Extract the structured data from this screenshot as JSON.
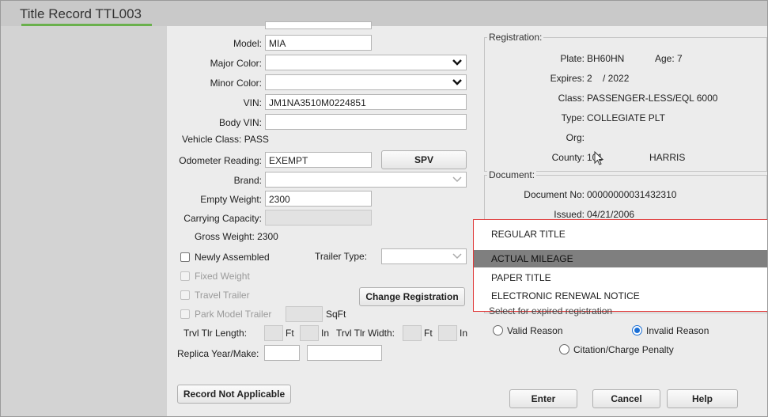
{
  "window": {
    "title": "Title Record TTL003"
  },
  "vehicle": {
    "model_label": "Model:",
    "model_value": "MIA",
    "major_color_label": "Major Color:",
    "major_color_value": "",
    "minor_color_label": "Minor Color:",
    "minor_color_value": "",
    "vin_label": "VIN:",
    "vin_value": "JM1NA3510M0224851",
    "body_vin_label": "Body VIN:",
    "body_vin_value": "",
    "vehicle_class_label": "Vehicle Class:",
    "vehicle_class_value": "PASS",
    "odometer_label": "Odometer Reading:",
    "odometer_value": "EXEMPT",
    "spv_label": "SPV",
    "brand_label": "Brand:",
    "brand_value": "",
    "empty_weight_label": "Empty Weight:",
    "empty_weight_value": "2300",
    "carrying_capacity_label": "Carrying Capacity:",
    "carrying_capacity_value": "",
    "gross_weight_label": "Gross Weight:",
    "gross_weight_value": "2300",
    "newly_assembled_label": "Newly Assembled",
    "trailer_type_label": "Trailer Type:",
    "trailer_type_value": "",
    "fixed_weight_label": "Fixed Weight",
    "travel_trailer_label": "Travel Trailer",
    "change_registration_label": "Change Registration",
    "park_model_trailer_label": "Park Model Trailer",
    "sqft_label": "SqFt",
    "trvl_tlr_length_label": "Trvl Tlr Length:",
    "ft_label": "Ft",
    "in_label": "In",
    "trvl_tlr_width_label": "Trvl Tlr Width:",
    "replica_label": "Replica Year/Make:",
    "record_not_applicable_label": "Record Not Applicable"
  },
  "registration": {
    "legend": "Registration:",
    "plate_label": "Plate:",
    "plate_value": "BH60HN",
    "age_label": "Age:",
    "age_value": "7",
    "expires_label": "Expires:",
    "expires_value": "2    / 2022",
    "class_label": "Class:",
    "class_value": "PASSENGER-LESS/EQL 6000",
    "type_label": "Type:",
    "type_value": "COLLEGIATE PLT",
    "org_label": "Org:",
    "org_value": "",
    "county_label": "County:",
    "county_code": "101",
    "county_name": "HARRIS"
  },
  "document": {
    "legend": "Document:",
    "doc_no_label": "Document No:",
    "doc_no_value": "00000000031432310",
    "issued_label": "Issued:",
    "issued_value": "04/21/2006",
    "title_type_selected": "REGULAR TITLE",
    "options": [
      "ACTUAL MILEAGE",
      "PAPER TITLE",
      "ELECTRONIC RENEWAL NOTICE"
    ],
    "expired_hint": "Select for expired registration",
    "valid_reason_label": "Valid Reason",
    "invalid_reason_label": "Invalid Reason",
    "citation_label": "Citation/Charge Penalty"
  },
  "footer": {
    "enter_label": "Enter",
    "cancel_label": "Cancel",
    "help_label": "Help"
  }
}
